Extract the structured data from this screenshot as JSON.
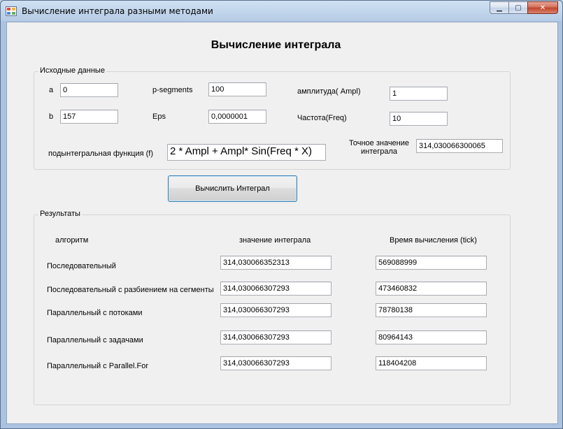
{
  "window": {
    "title": "Вычисление интеграла разными методами",
    "minimize_glyph": "▁",
    "maximize_glyph": "▢",
    "close_glyph": "✕"
  },
  "heading": "Вычисление интеграла",
  "input_group": {
    "title": "Исходные данные",
    "a_label": "a",
    "a_value": "0",
    "b_label": "b",
    "b_value": "157",
    "segments_label": "p-segments",
    "segments_value": "100",
    "eps_label": "Eps",
    "eps_value": "0,0000001",
    "ampl_label": "амплитуда( Ampl)",
    "ampl_value": "1",
    "freq_label": "Частота(Freq)",
    "freq_value": "10",
    "func_label": "подынтегральная функция (f)",
    "func_value": "2 * Ampl + Ampl* Sin(Freq * X)",
    "exact_label_line1": "Точное значение",
    "exact_label_line2": "интеграла",
    "exact_value": "314,030066300065"
  },
  "compute_button": "Вычислить Интеграл",
  "results_group": {
    "title": "Результаты",
    "col_algorithm": "алгоритм",
    "col_value": "значение интеграла",
    "col_time": "Время вычисления (tick)",
    "rows": [
      {
        "name": "Последовательный",
        "value": "314,030066352313",
        "time": "569088999"
      },
      {
        "name": "Последовательный с разбиением на сегменты",
        "value": "314,030066307293",
        "time": "473460832"
      },
      {
        "name": "Параллельный с потоками",
        "value": "314,030066307293",
        "time": "78780138"
      },
      {
        "name": "Параллельный с задачами",
        "value": "314,030066307293",
        "time": "80964143"
      },
      {
        "name": "Параллельный с Parallel.For",
        "value": "314,030066307293",
        "time": "118404208"
      }
    ]
  },
  "colors": {
    "accent_border": "#3c7fb1",
    "client_bg": "#f0f0f0",
    "close_red": "#c2442b"
  }
}
